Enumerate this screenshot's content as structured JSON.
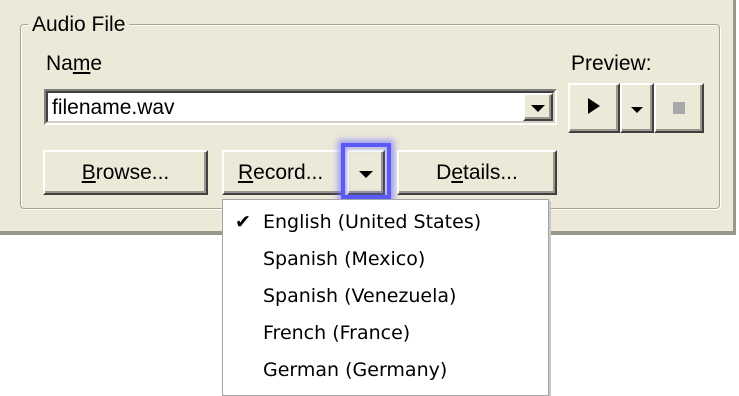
{
  "group": {
    "title": "Audio File",
    "name_label_pre": "Na",
    "name_label_accel": "m",
    "name_label_post": "e",
    "preview_label": "Preview:"
  },
  "name_combo": {
    "value": "filename.wav",
    "dropdown_icon": "triangle-down-icon"
  },
  "preview_controls": {
    "play_icon": "play-icon",
    "dropdown_icon": "triangle-down-icon",
    "stop_icon": "stop-icon"
  },
  "buttons": {
    "browse_accel": "B",
    "browse_rest": "rowse...",
    "record_accel": "R",
    "record_rest": "ecord...",
    "details_pre": "D",
    "details_accel": "e",
    "details_post": "tails..."
  },
  "language_menu": {
    "items": [
      {
        "label": "English (United States)",
        "checked": true
      },
      {
        "label": "Spanish (Mexico)",
        "checked": false
      },
      {
        "label": "Spanish (Venezuela)",
        "checked": false
      },
      {
        "label": "French (France)",
        "checked": false
      },
      {
        "label": "German (Germany)",
        "checked": false
      }
    ],
    "check_glyph": "✔"
  },
  "colors": {
    "face": "#ece9d8",
    "focus": "#5a5af8",
    "disabled": "#a8a8a8"
  }
}
